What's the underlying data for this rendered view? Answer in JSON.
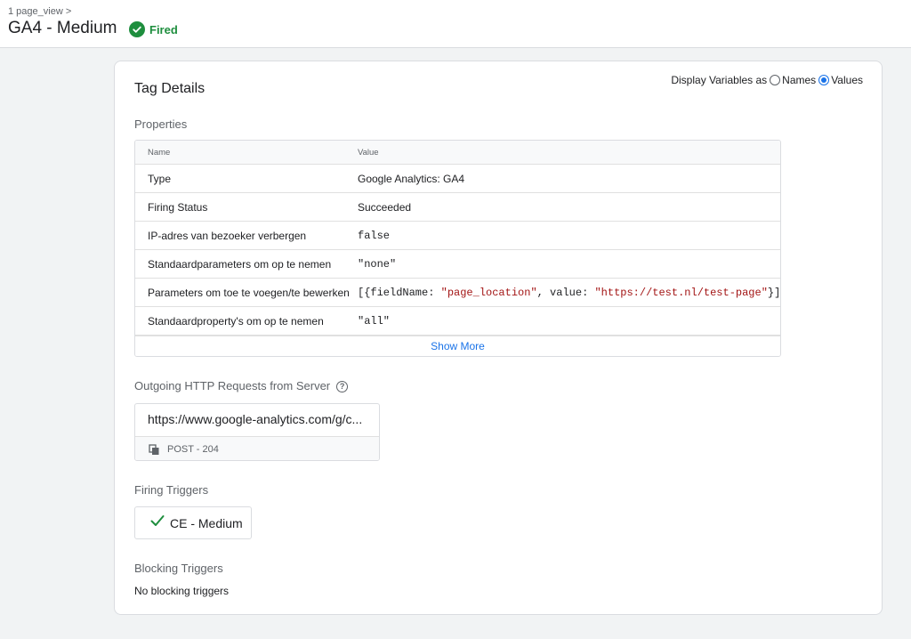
{
  "header": {
    "breadcrumb": "1 page_view >",
    "title": "GA4 - Medium",
    "status": "Fired",
    "status_color": "#1e8e3e",
    "status_icon": "check-circle-icon"
  },
  "card": {
    "title": "Tag Details",
    "display_variables": {
      "label": "Display Variables as",
      "options": [
        "Names",
        "Values"
      ],
      "selected": "Values"
    }
  },
  "properties": {
    "section_title": "Properties",
    "columns": [
      "Name",
      "Value"
    ],
    "rows": [
      {
        "name": "Type",
        "value": "Google Analytics: GA4"
      },
      {
        "name": "Firing Status",
        "value": "Succeeded"
      },
      {
        "name": "IP-adres van bezoeker verbergen",
        "value": "false"
      },
      {
        "name": "Standaardparameters om op te nemen",
        "value": "\"none\""
      },
      {
        "name": "Parameters om toe te voegen/te bewerken",
        "value_parts": [
          "[{fieldName: ",
          "\"page_location\"",
          ", value: ",
          "\"https://test.nl/test-page\"",
          "}]"
        ]
      },
      {
        "name": "Standaardproperty's om op te nemen",
        "value": "\"all\""
      }
    ],
    "show_more": "Show More"
  },
  "outgoing": {
    "section_title": "Outgoing HTTP Requests from Server",
    "help_icon": "?",
    "request_url": "https://www.google-analytics.com/g/c...",
    "request_status": "POST - 204",
    "copy_icon": "copy-icon"
  },
  "firing_triggers": {
    "section_title": "Firing Triggers",
    "items": [
      {
        "label": "CE - Medium",
        "icon": "check-icon"
      }
    ]
  },
  "blocking_triggers": {
    "section_title": "Blocking Triggers",
    "empty_text": "No blocking triggers"
  },
  "colors": {
    "accent": "#1a73e8",
    "success": "#1e8e3e",
    "string": "#a31515",
    "keyword": "#1a237e"
  }
}
